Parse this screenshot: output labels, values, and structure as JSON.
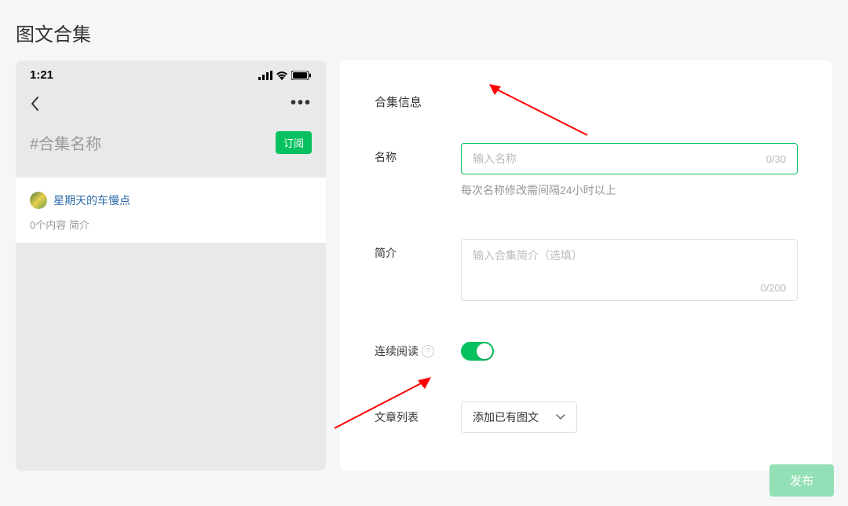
{
  "page": {
    "title": "图文合集"
  },
  "phone": {
    "time": "1:21",
    "collection_placeholder": "#合集名称",
    "subscribe_label": "订阅",
    "author_name": "星期天的车慢点",
    "meta": "0个内容  简介",
    "more": "•••"
  },
  "form": {
    "section_title": "合集信息",
    "name": {
      "label": "名称",
      "placeholder": "输入名称",
      "counter": "0/30",
      "hint": "每次名称修改需间隔24小时以上"
    },
    "intro": {
      "label": "简介",
      "placeholder": "输入合集简介（选填）",
      "counter": "0/200"
    },
    "continuous": {
      "label": "连续阅读"
    },
    "articles": {
      "label": "文章列表",
      "button": "添加已有图文"
    }
  },
  "publish": {
    "label": "发布"
  }
}
